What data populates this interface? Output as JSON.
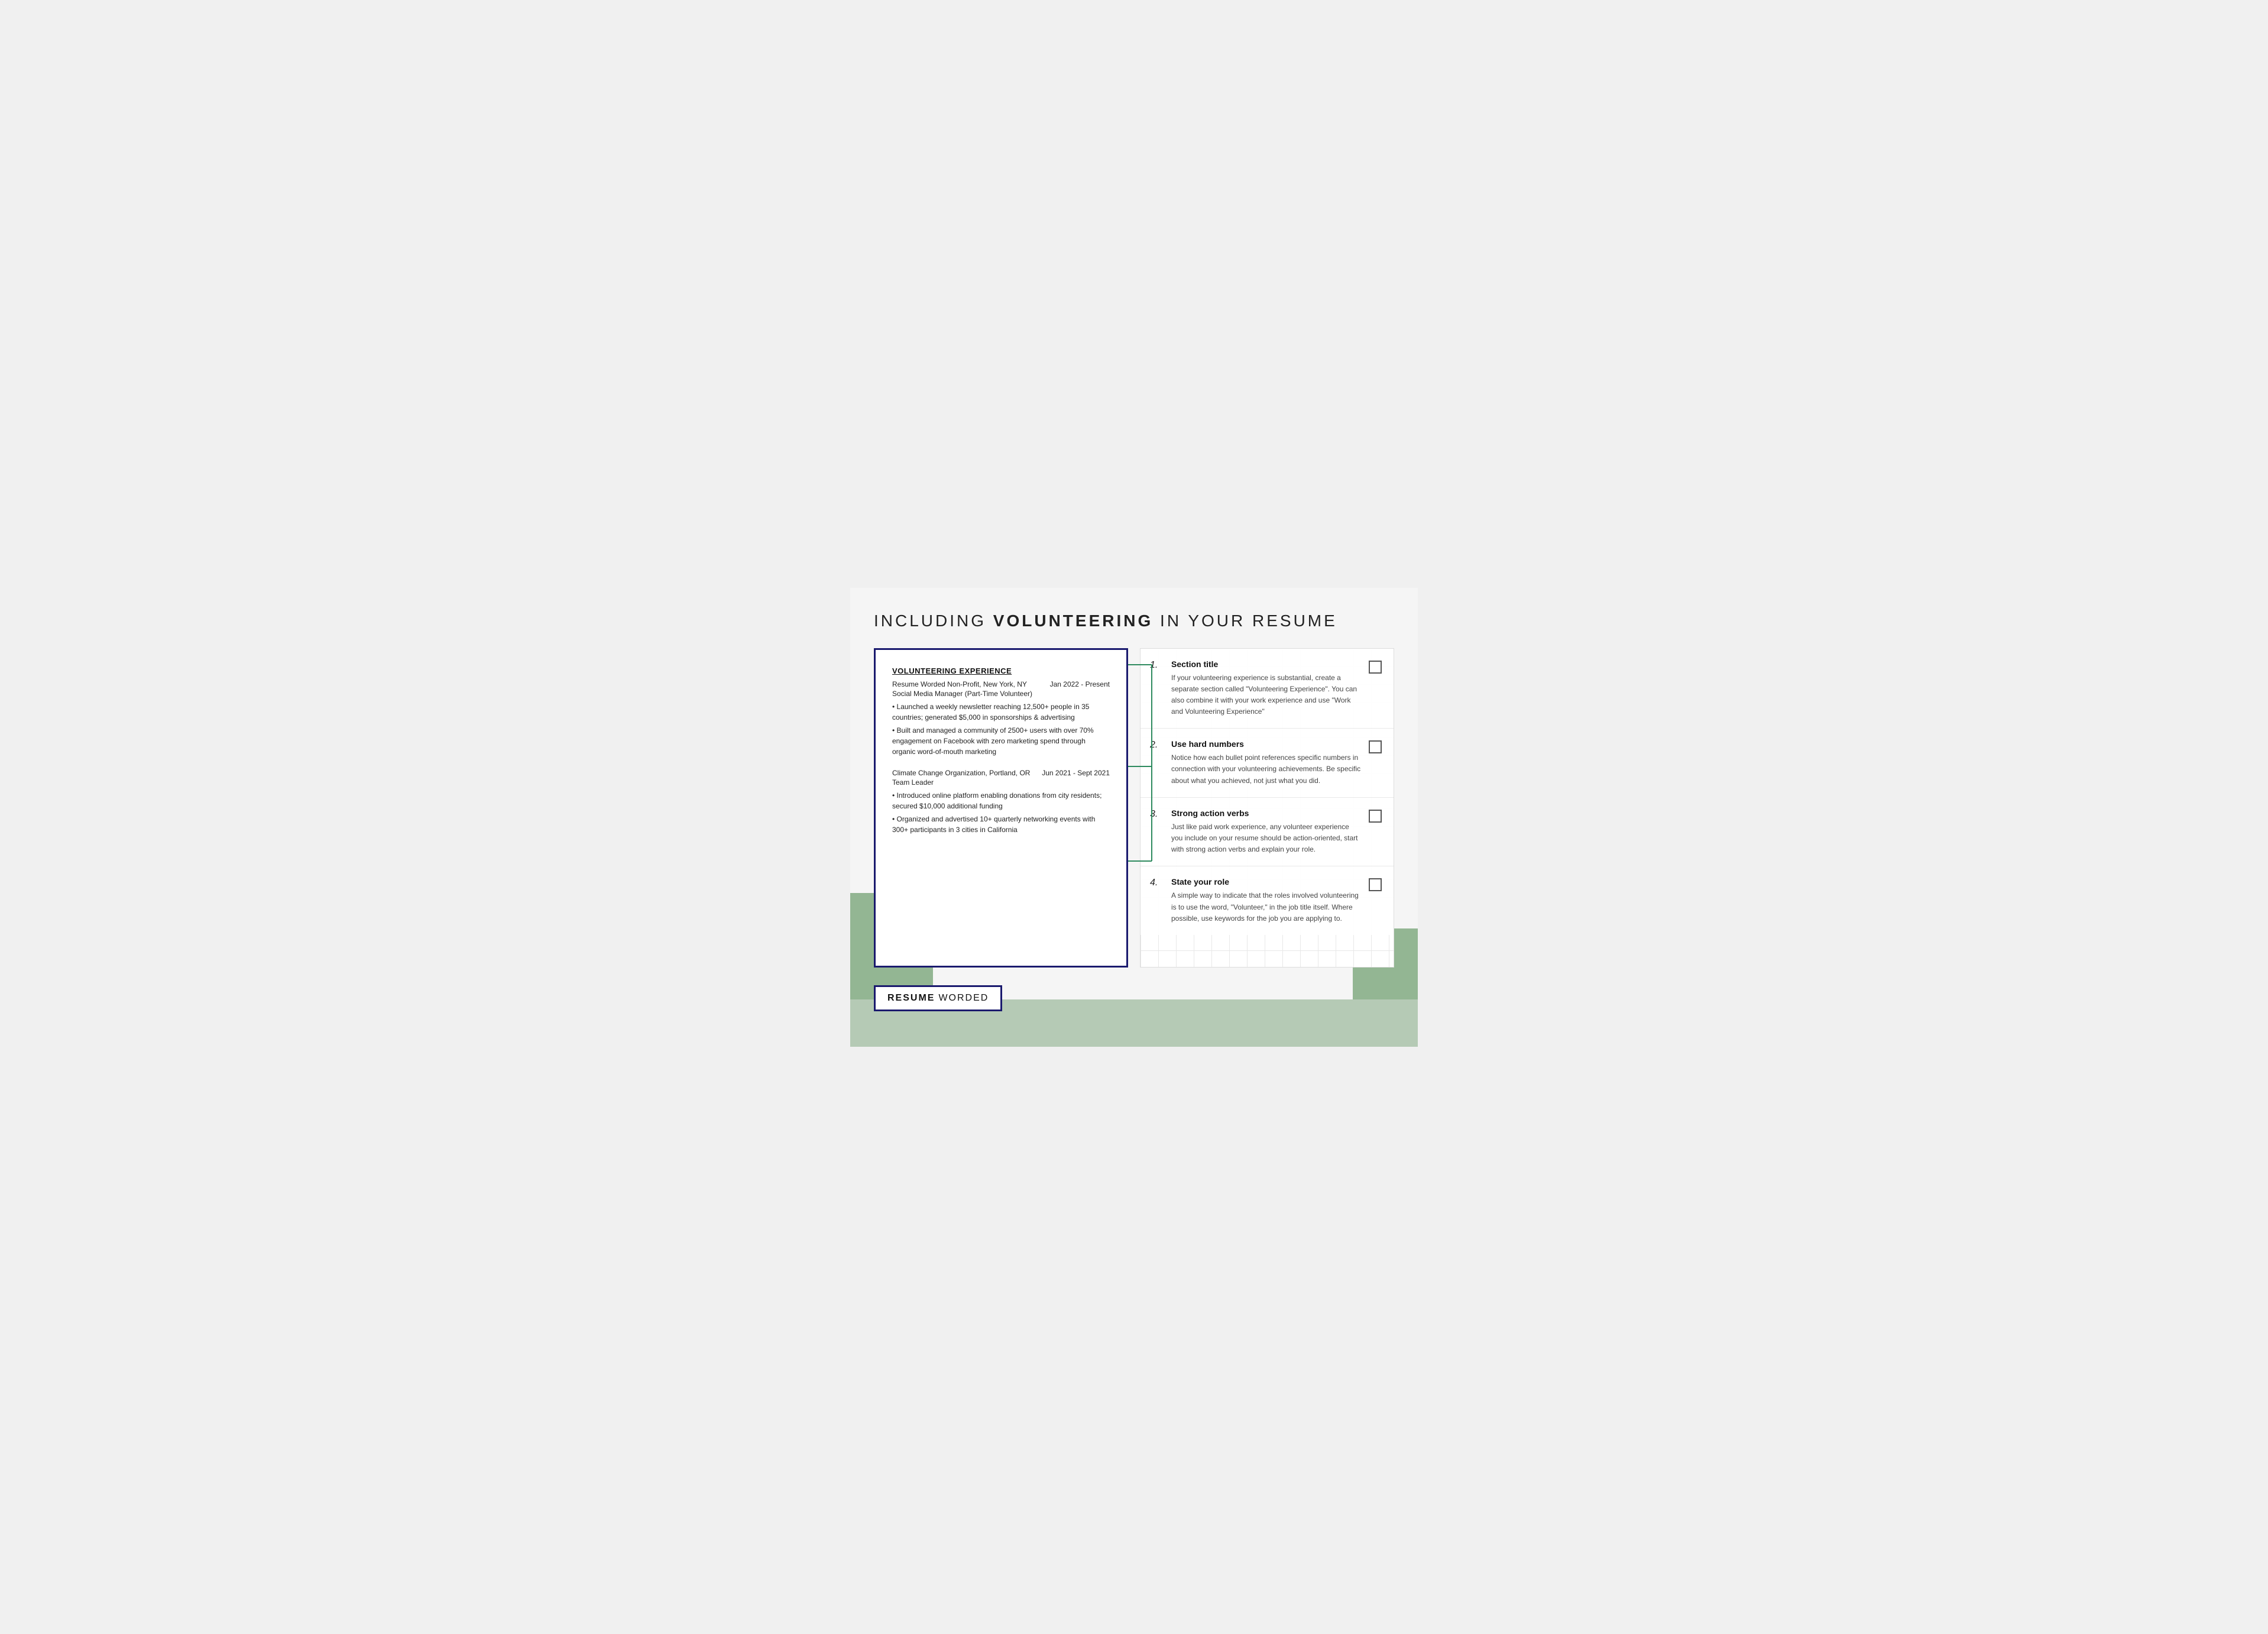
{
  "page": {
    "title_prefix": "INCLUDING ",
    "title_bold": "VOLUNTEERING",
    "title_suffix": " IN YOUR RESUME"
  },
  "resume": {
    "section_title": "VOLUNTEERING EXPERIENCE",
    "entries": [
      {
        "org": "Resume Worded Non-Profit, New York, NY",
        "date": "Jan 2022 - Present",
        "role": "Social Media Manager (Part-Time Volunteer)",
        "bullets": [
          "• Launched a weekly newsletter reaching 12,500+ people in 35 countries; generated $5,000 in sponsorships & advertising",
          "• Built and managed a community of 2500+ users with over 70% engagement on Facebook with zero marketing spend through organic word-of-mouth marketing"
        ]
      },
      {
        "org": "Climate Change Organization, Portland, OR",
        "date": "Jun 2021 - Sept 2021",
        "role": "Team Leader",
        "bullets": [
          "• Introduced online platform enabling donations from city residents; secured $10,000 additional funding",
          "• Organized and advertised 10+ quarterly networking events with 300+ participants in 3 cities in California"
        ]
      }
    ]
  },
  "tips": [
    {
      "number": "1.",
      "title": "Section title",
      "description": "If your volunteering experience is substantial, create a separate section called \"Volunteering Experience\". You can also combine it with your work experience and use \"Work and Volunteering Experience\""
    },
    {
      "number": "2.",
      "title": "Use hard numbers",
      "description": "Notice how each bullet point references specific numbers in connection with your volunteering achievements. Be specific about what you achieved, not just what you did."
    },
    {
      "number": "3.",
      "title": "Strong action verbs",
      "description": "Just like paid work experience, any volunteer experience you include on your resume should be action-oriented, start with strong action verbs and explain your role."
    },
    {
      "number": "4.",
      "title": "State your role",
      "description": "A simple way to indicate that the roles involved volunteering is to use the word, \"Volunteer,\" in the job title itself. Where possible, use keywords for the job you are applying to."
    }
  ],
  "branding": {
    "resume_label": "RESUME",
    "worded_label": "WORDED"
  }
}
